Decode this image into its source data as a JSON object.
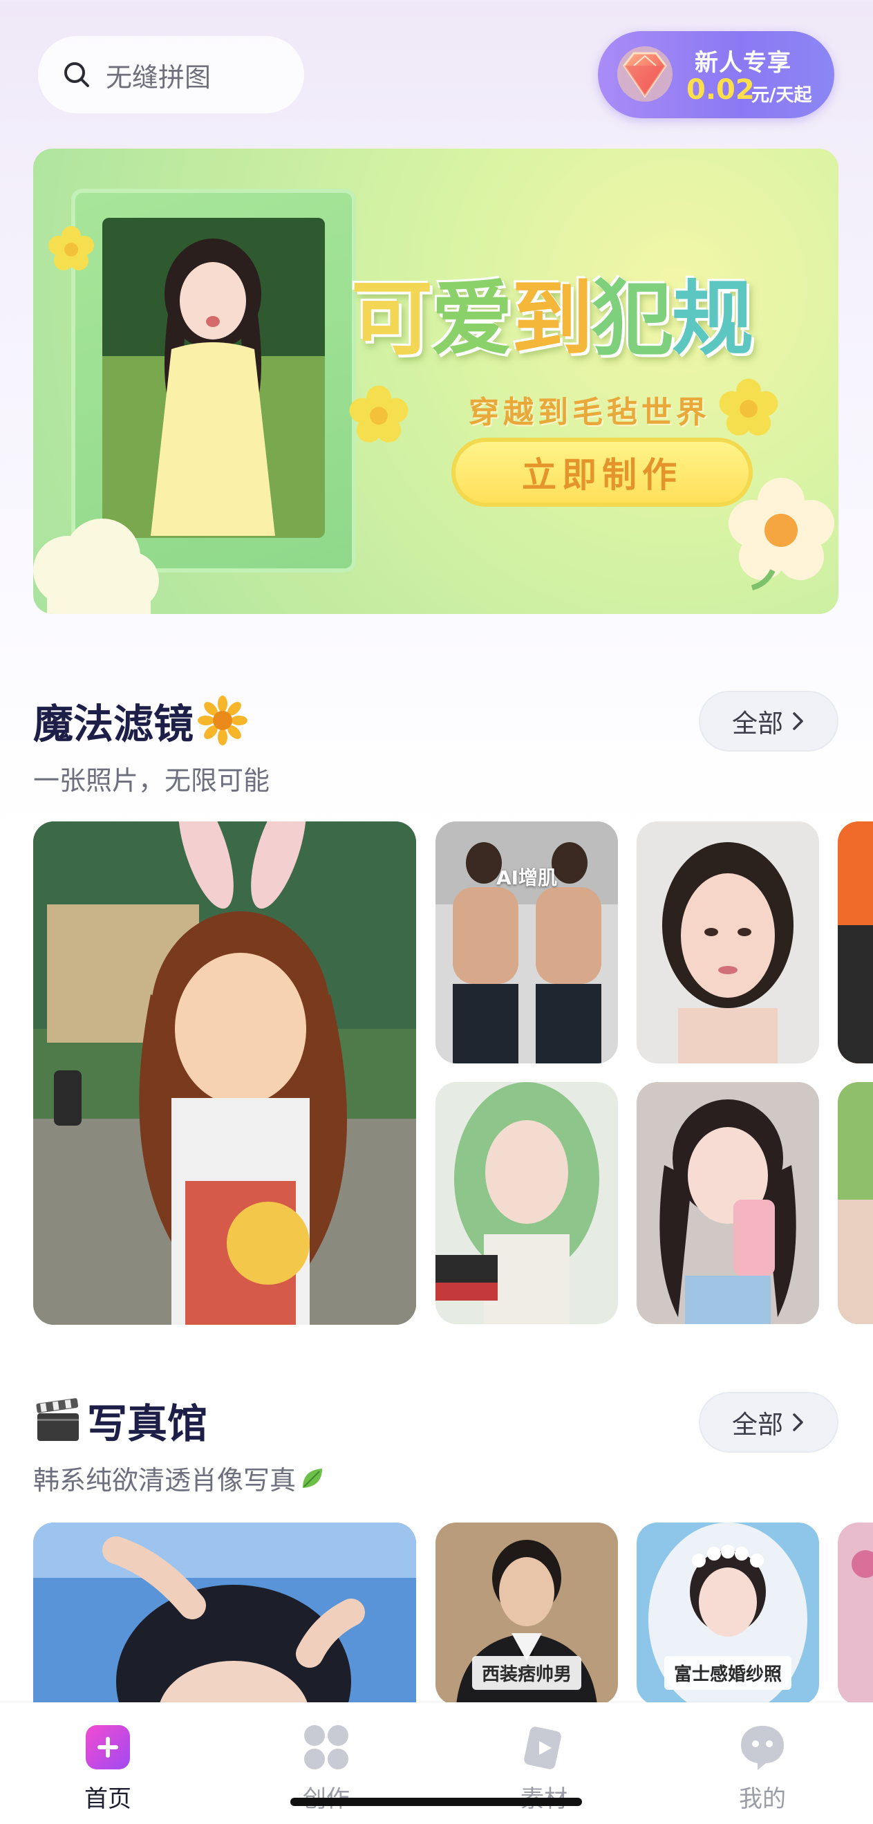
{
  "search": {
    "placeholder": "无缝拼图"
  },
  "promo": {
    "title": "新人专享",
    "price": "0.02",
    "unit": "元/天起"
  },
  "banner": {
    "headline": [
      "可",
      "爱",
      "到",
      "犯",
      "规"
    ],
    "subtitle": "穿越到毛毡世界",
    "cta": "立即制作"
  },
  "sections": [
    {
      "title": "魔法滤镜",
      "title_emoji": "sunflower",
      "subtitle": "一张照片，无限可能",
      "all_label": "全部",
      "card_tags": [
        "AI增肌"
      ]
    },
    {
      "title": "写真馆",
      "title_emoji": "clapperboard",
      "subtitle": "韩系纯欲清透肖像写真",
      "subtitle_emoji": "leaf",
      "all_label": "全部",
      "card_labels": [
        "西装痞帅男",
        "富士感婚纱照"
      ]
    }
  ],
  "tabs": [
    {
      "label": "首页",
      "icon": "plus-icon",
      "active": true
    },
    {
      "label": "创作",
      "icon": "grid-icon",
      "active": false
    },
    {
      "label": "素材",
      "icon": "media-card-icon",
      "active": false
    },
    {
      "label": "我的",
      "icon": "chat-face-icon",
      "active": false
    }
  ],
  "colors": {
    "accent": "#8b79f3",
    "promo_price": "#ffe04a",
    "tab_active": "#e84bd3"
  }
}
